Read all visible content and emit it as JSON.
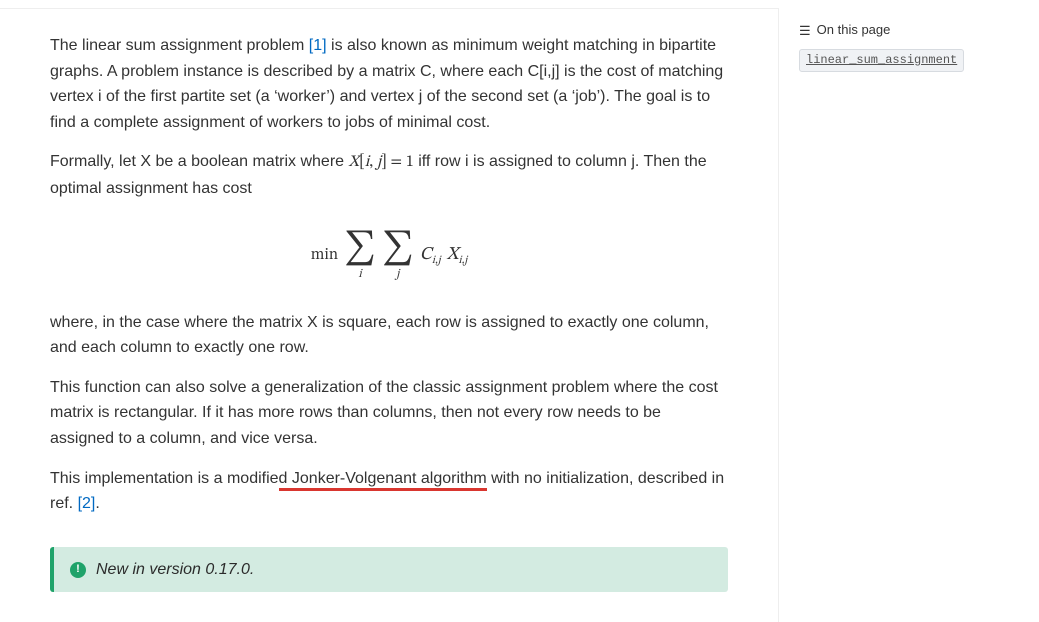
{
  "sidebar": {
    "title": "On this page",
    "item": "linear_sum_assignment"
  },
  "para1": {
    "pre": "The linear sum assignment problem ",
    "ref": "[1]",
    "post": " is also known as minimum weight matching in bipartite graphs. A problem instance is described by a matrix C, where each C[i,j] is the cost of matching vertex i of the first partite set (a ‘worker’) and vertex j of the second set (a ‘job’). The goal is to find a complete assignment of workers to jobs of minimal cost."
  },
  "para2": {
    "pre": "Formally, let X be a boolean matrix where ",
    "math_x": "X",
    "math_lb": "[",
    "math_i": "i",
    "math_comma": ", ",
    "math_j": "j",
    "math_rb": "]",
    "math_eq": " = 1",
    "post": " iff row i is assigned to column j. Then the optimal assignment has cost"
  },
  "equation": {
    "min": "min",
    "sigma": "∑",
    "sub_i": "i",
    "sub_j": "j",
    "C": "C",
    "X": "X",
    "subscript": "i,j"
  },
  "para3": "where, in the case where the matrix X is square, each row is assigned to exactly one column, and each column to exactly one row.",
  "para4": "This function can also solve a generalization of the classic assignment problem where the cost matrix is rectangular. If it has more rows than columns, then not every row needs to be assigned to a column, and vice versa.",
  "para5": {
    "pre": "This implementation is a modifie",
    "mark": "d Jonker-Volgenant algorithm",
    "post": " with no initialization, described in ref. ",
    "ref": "[2]",
    "period": "."
  },
  "admonition": {
    "text": "New in version 0.17.0."
  }
}
